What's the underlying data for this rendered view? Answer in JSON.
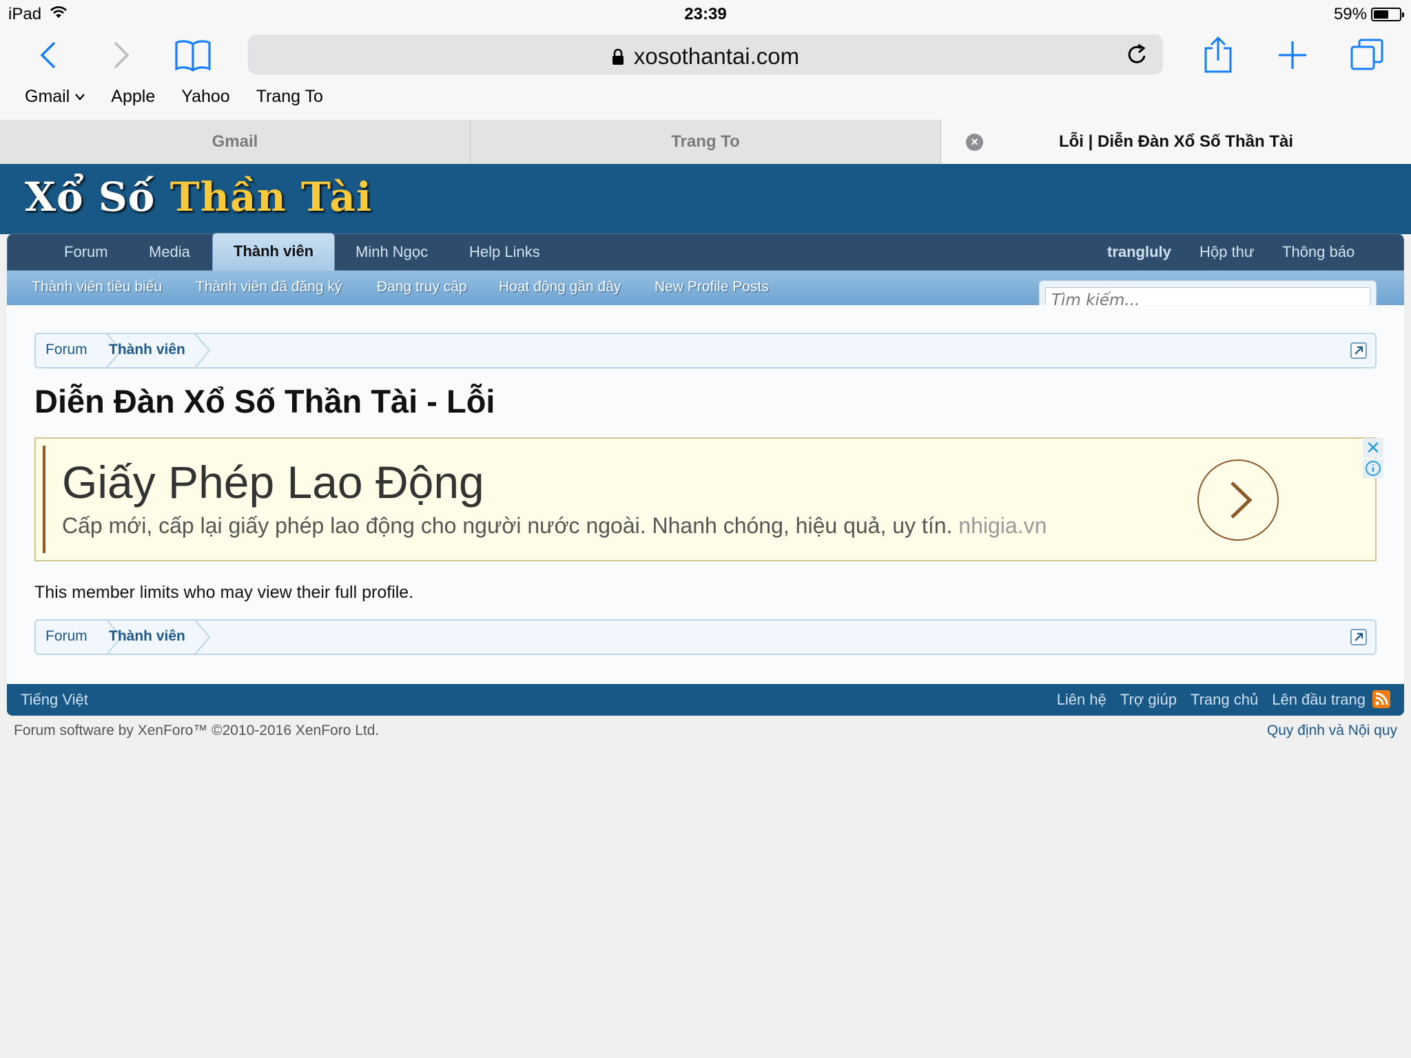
{
  "status_bar": {
    "device": "iPad",
    "time": "23:39",
    "battery": "59%",
    "battery_level": 0.59
  },
  "safari": {
    "url": "xosothantai.com",
    "bookmarks": [
      "Gmail",
      "Apple",
      "Yahoo",
      "Trang To"
    ],
    "tabs": [
      {
        "label": "Gmail",
        "active": false
      },
      {
        "label": "Trang To",
        "active": false
      },
      {
        "label": "Lỗi | Diễn Đàn Xổ Số Thần Tài",
        "active": true
      }
    ]
  },
  "logo": {
    "part1": "Xổ Số",
    "part2": "Thần Tài"
  },
  "nav": {
    "items": [
      "Forum",
      "Media",
      "Thành viên",
      "Minh Ngọc",
      "Help Links"
    ],
    "active": "Thành viên",
    "user": "trangluly",
    "inbox": "Hộp thư",
    "alerts": "Thông báo"
  },
  "subnav": {
    "items": [
      "Thành viên tiêu biểu",
      "Thành viên đã đăng ký",
      "Đang truy cập",
      "Hoạt động gần đây",
      "New Profile Posts"
    ]
  },
  "search": {
    "placeholder": "Tìm kiếm..."
  },
  "breadcrumb": {
    "items": [
      "Forum",
      "Thành viên"
    ]
  },
  "page_title": "Diễn Đàn Xổ Số Thần Tài - Lỗi",
  "ad": {
    "headline": "Giấy Phép Lao Động",
    "description": "Cấp mới, cấp lại giấy phép lao động cho người nước ngoài. Nhanh chóng, hiệu quả, uy tín.",
    "domain": "nhigia.vn"
  },
  "message": "This member limits who may view their full profile.",
  "footer": {
    "language": "Tiếng Việt",
    "links": [
      "Liên hệ",
      "Trợ giúp",
      "Trang chủ",
      "Lên đầu trang"
    ],
    "copyright": "Forum software by XenForo™ ©2010-2016 XenForo Ltd.",
    "rules": "Quy định và Nội quy"
  },
  "colors": {
    "header_blue": "#185886",
    "nav_dark": "#2e4c6b",
    "subnav_light": "#94bfe2",
    "logo_gold": "#f7c93c",
    "link_blue": "#1c5787"
  }
}
